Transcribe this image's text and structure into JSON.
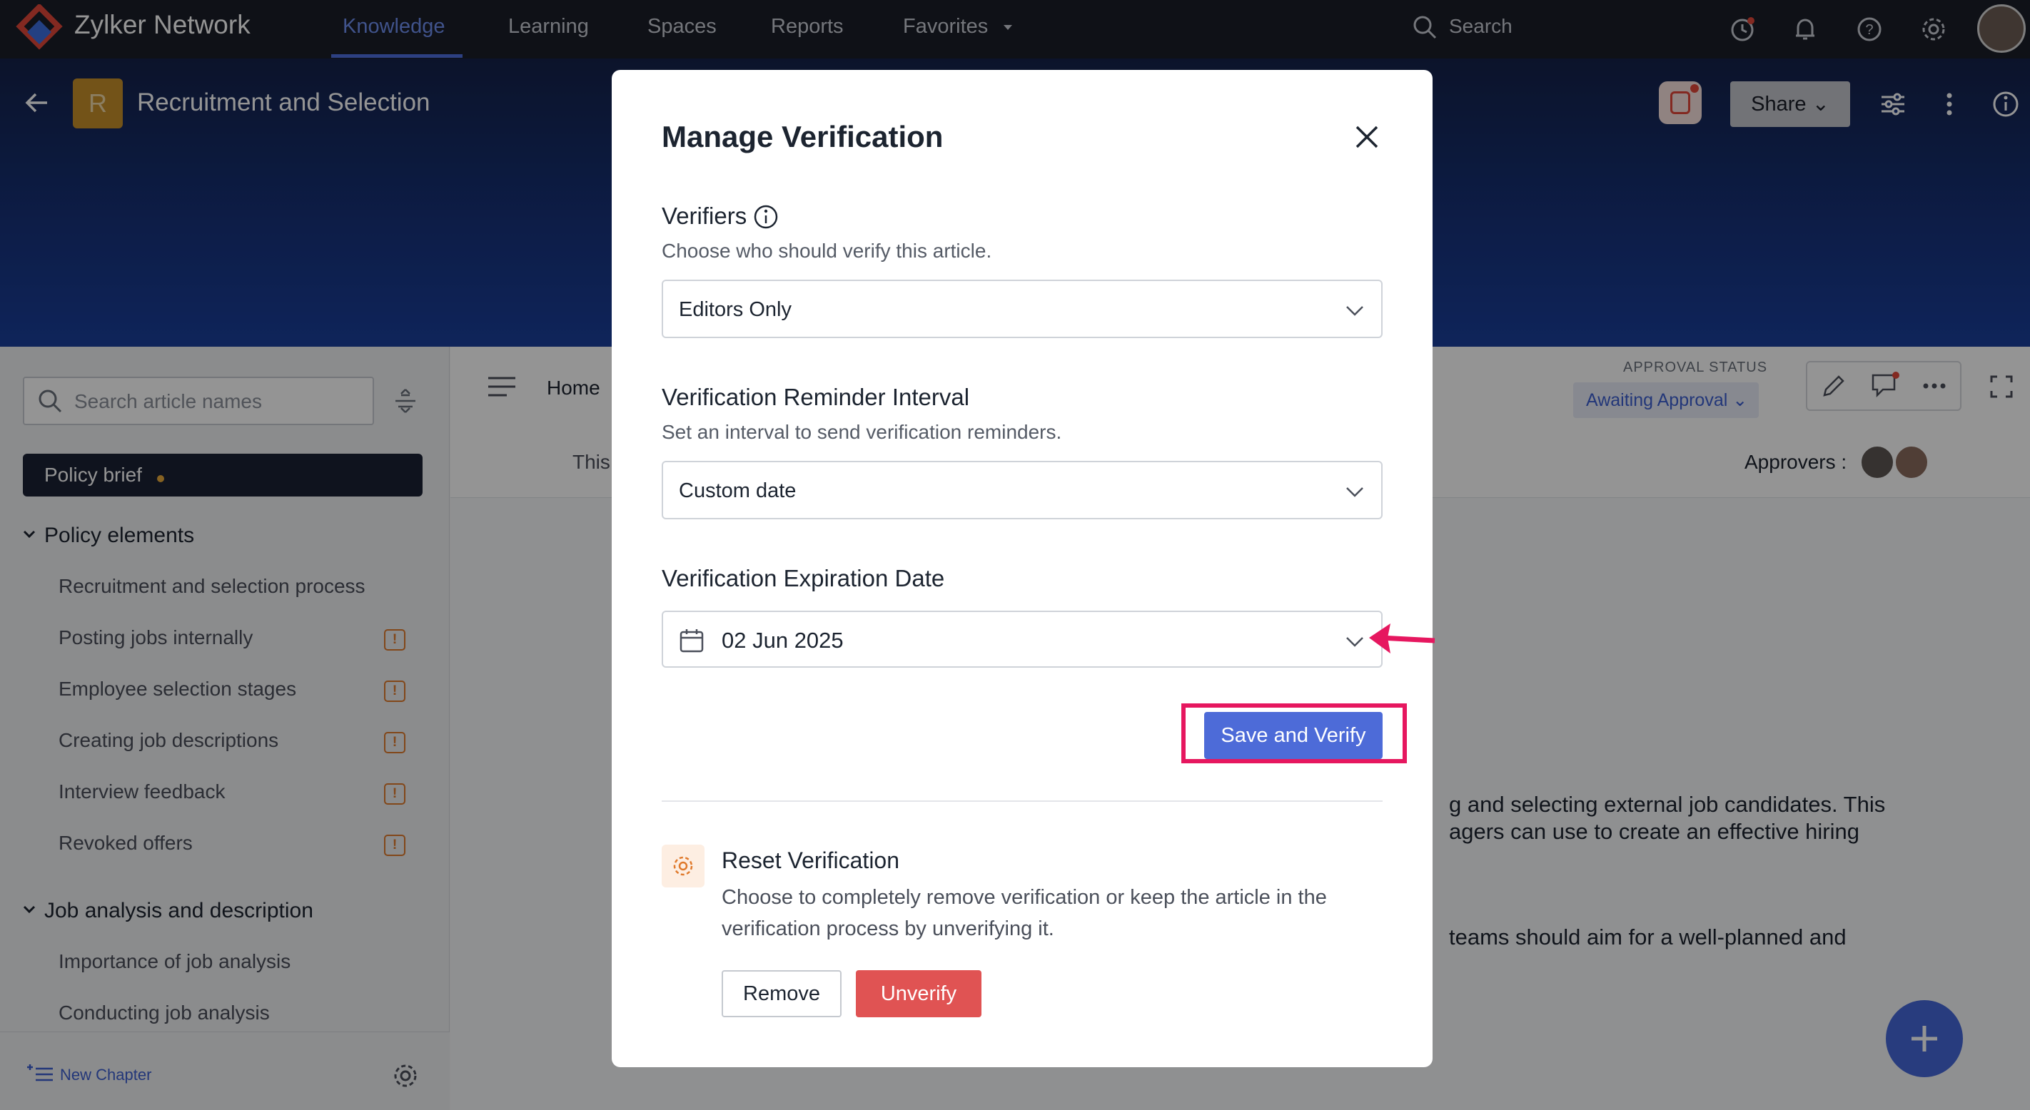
{
  "nav": {
    "brand": "Zylker Network",
    "tabs": [
      {
        "label": "Knowledge",
        "active": true
      },
      {
        "label": "Learning"
      },
      {
        "label": "Spaces"
      },
      {
        "label": "Reports"
      },
      {
        "label": "Favorites"
      }
    ],
    "search_label": "Search",
    "icons": [
      "history-icon",
      "bell-icon",
      "help-icon",
      "gear-icon",
      "avatar"
    ]
  },
  "header": {
    "badge_letter": "R",
    "title": "Recruitment and Selection",
    "share_label": "Share"
  },
  "sidebar": {
    "search_placeholder": "Search article names",
    "active_item": "Policy brief",
    "sections": [
      {
        "title": "Policy elements",
        "items": [
          {
            "label": "Recruitment and selection process",
            "warn": false
          },
          {
            "label": "Posting jobs internally",
            "warn": true
          },
          {
            "label": "Employee selection stages",
            "warn": true
          },
          {
            "label": "Creating job descriptions",
            "warn": true
          },
          {
            "label": "Interview feedback",
            "warn": true
          },
          {
            "label": "Revoked offers",
            "warn": true
          }
        ]
      },
      {
        "title": "Job analysis and description",
        "items": [
          {
            "label": "Importance of job analysis",
            "warn": false
          },
          {
            "label": "Conducting job analysis",
            "warn": false
          }
        ]
      }
    ],
    "new_chapter": "New Chapter"
  },
  "main": {
    "breadcrumb_home": "Home",
    "approval_status_label": "APPROVAL STATUS",
    "approval_status_value": "Awaiting Approval",
    "approvers_label": "Approvers :",
    "this_text": "This",
    "body_lines": [
      "g and selecting external job candidates. This",
      "agers can use to create an effective hiring",
      "teams should aim for a well-planned and"
    ]
  },
  "modal": {
    "title": "Manage Verification",
    "verifiers": {
      "heading": "Verifiers",
      "description": "Choose who should verify this article.",
      "value": "Editors Only"
    },
    "reminder": {
      "heading": "Verification Reminder Interval",
      "description": "Set an interval to send verification reminders.",
      "value": "Custom date"
    },
    "expiration": {
      "heading": "Verification Expiration Date",
      "value": "02 Jun 2025"
    },
    "save_label": "Save and Verify",
    "reset": {
      "heading": "Reset Verification",
      "description": "Choose to completely remove verification or keep the article in the verification process by unverifying it.",
      "remove_label": "Remove",
      "unverify_label": "Unverify"
    }
  },
  "colors": {
    "nav_bg": "#1b1e28",
    "hero": "#17337d",
    "primary": "#4d6bd8",
    "danger": "#e05353",
    "highlight": "#e6175f"
  }
}
